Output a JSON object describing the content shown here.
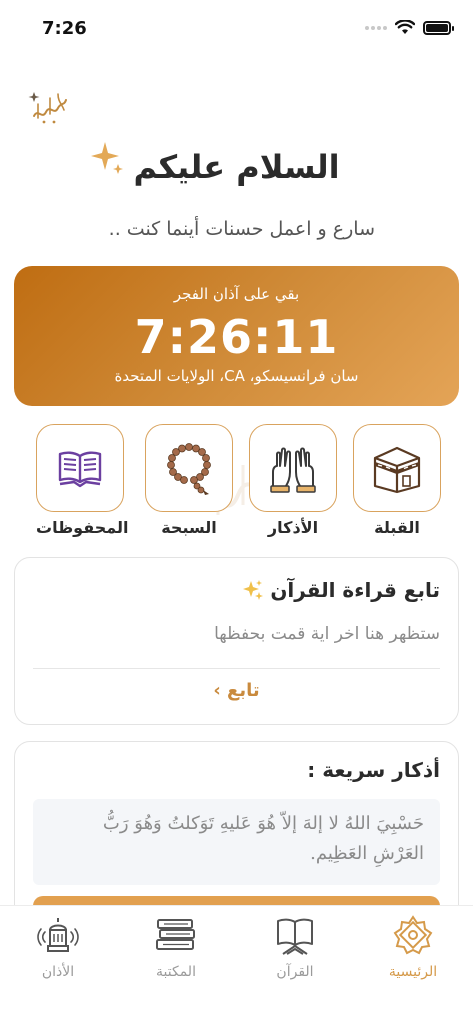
{
  "status_bar": {
    "time": "7:26"
  },
  "header": {
    "logo_icon": "calligraphy-logo-icon",
    "greeting": "السلام عليكم",
    "subtitle": "سارع و اعمل حسنات أينما كنت .."
  },
  "prayer_card": {
    "label": "بقي على آذان الفجر",
    "countdown": "7:26:11",
    "location": "سان فرانسيسكو، CA، الولايات المتحدة"
  },
  "quick_actions": [
    {
      "label": "القبلة",
      "icon": "kaaba-icon"
    },
    {
      "label": "الأذكار",
      "icon": "praying-hands-icon"
    },
    {
      "label": "السبحة",
      "icon": "prayer-beads-icon"
    },
    {
      "label": "المحفوظات",
      "icon": "open-book-icon"
    }
  ],
  "continue_reading": {
    "title": "تابع قراءة القرآن",
    "body": "ستظهر هنا اخر اية قمت بحفظها",
    "button": "تابع ›"
  },
  "quick_azkar": {
    "title": "أذكار سريعة :",
    "dhikr": "حَسْبِيَ اللهُ لا إلهَ إلاّ هُوَ عَليهِ تَوَكلتُ وَهُوَ رَبُّ العَرْشِ العَظِيم."
  },
  "tabbar": [
    {
      "label": "الرئيسية",
      "icon": "home-star-icon",
      "active": true
    },
    {
      "label": "القرآن",
      "icon": "quran-book-icon",
      "active": false
    },
    {
      "label": "المكتبة",
      "icon": "books-stack-icon",
      "active": false
    },
    {
      "label": "الأذان",
      "icon": "mosque-speaker-icon",
      "active": false
    }
  ],
  "colors": {
    "accent": "#d59a4a",
    "card_gradient_start": "#bf6d12",
    "card_gradient_end": "#e4a457",
    "purple_icon": "#6b3fa0"
  }
}
